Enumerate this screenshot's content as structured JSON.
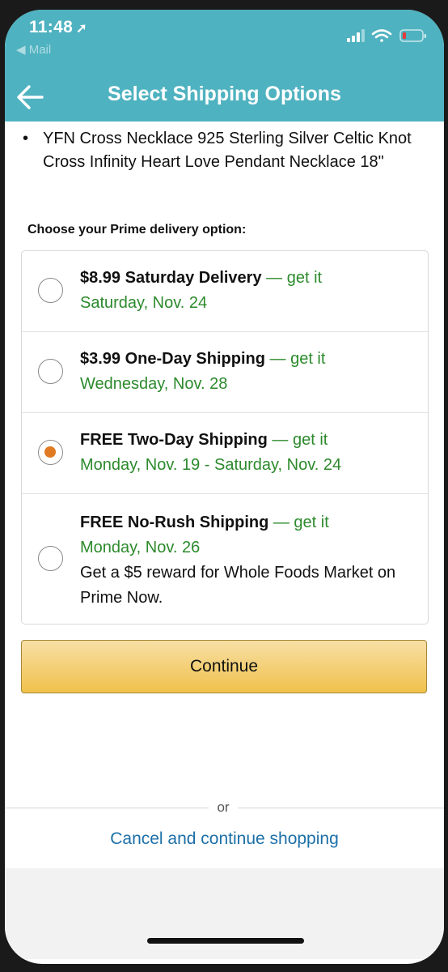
{
  "status_bar": {
    "time": "11:48",
    "location_arrow": "location-arrow-icon",
    "back_app": "◀ Mail",
    "icons": [
      "signal-icon",
      "wifi-icon",
      "battery-icon"
    ]
  },
  "nav": {
    "title": "Select Shipping Options",
    "back_icon": "back-arrow-icon"
  },
  "product": {
    "bullet": "•",
    "name": "YFN Cross Necklace 925 Sterling Silver Celtic Knot Cross Infinity Heart Love Pendant Necklace 18\""
  },
  "prompt": "Choose your Prime delivery option:",
  "options": [
    {
      "name": "$8.99 Saturday Delivery",
      "get_it": " — get it",
      "date": "Saturday, Nov. 24",
      "extra": "",
      "selected": false
    },
    {
      "name": "$3.99 One-Day Shipping",
      "get_it": " — get it",
      "date": "Wednesday, Nov. 28",
      "extra": "",
      "selected": false
    },
    {
      "name": "FREE Two-Day Shipping",
      "get_it": " — get it",
      "date": "Monday, Nov. 19 - Saturday, Nov. 24",
      "extra": "",
      "selected": true
    },
    {
      "name": "FREE No-Rush Shipping",
      "get_it": " — get it",
      "date": "Monday, Nov. 26",
      "extra": "Get a $5 reward for Whole Foods Market on Prime Now.",
      "selected": false
    }
  ],
  "continue_label": "Continue",
  "or_label": "or",
  "cancel_label": "Cancel and continue shopping",
  "colors": {
    "header": "#4fb2c0",
    "green": "#2c8a2c",
    "radio_selected": "#e07b24",
    "button": "#f0c14b",
    "link": "#1c6fa8"
  }
}
